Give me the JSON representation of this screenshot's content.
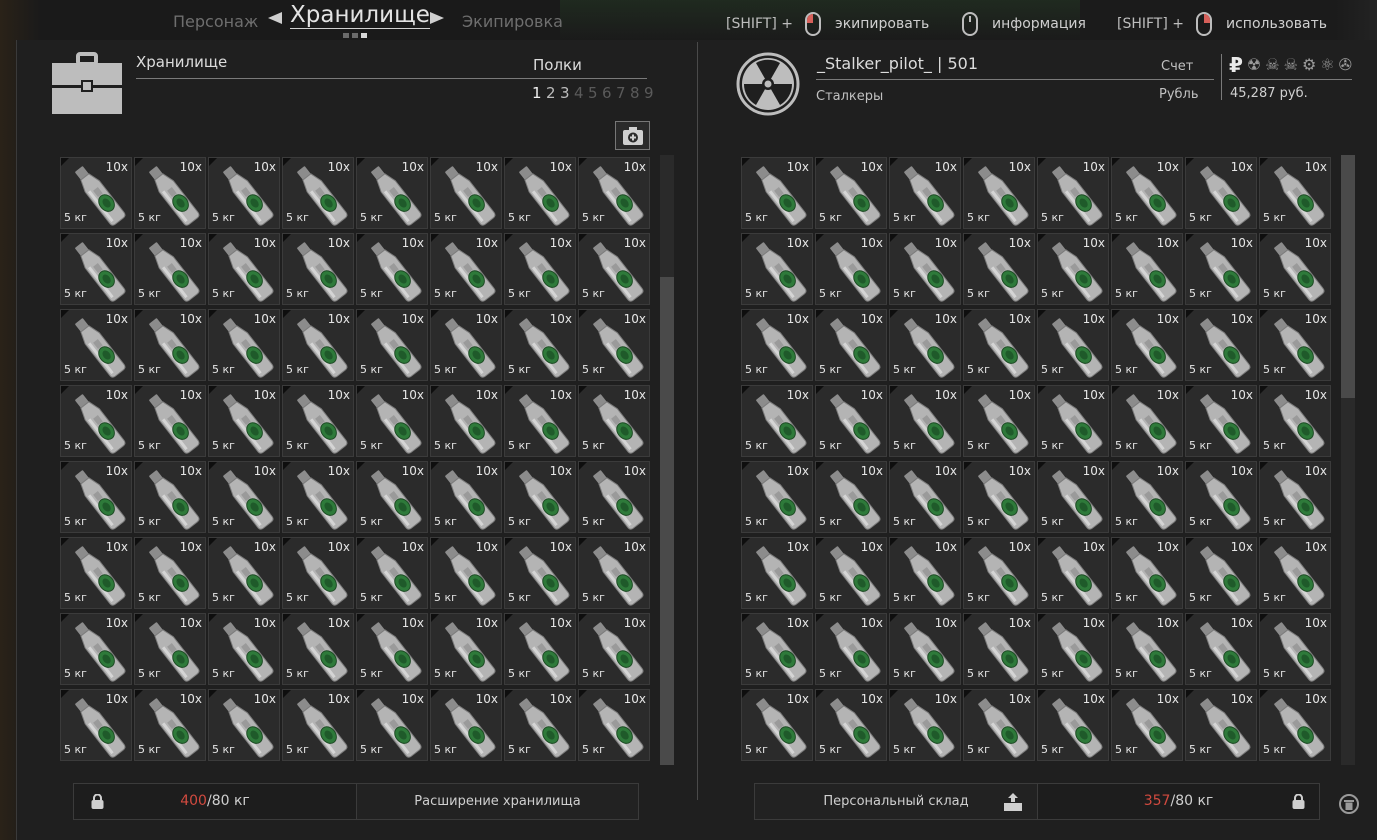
{
  "nav": {
    "prev": "Персонаж",
    "title": "Хранилище",
    "next": "Экипировка",
    "hints": [
      {
        "shift": "[SHIFT] +",
        "mouse": "left",
        "label": "экипировать"
      },
      {
        "shift": "",
        "mouse": "mid",
        "label": "информация"
      },
      {
        "shift": "[SHIFT] +",
        "mouse": "right",
        "label": "использовать"
      }
    ]
  },
  "storage": {
    "title": "Хранилище",
    "shelves_label": "Полки",
    "shelves": [
      "1",
      "2",
      "3",
      "4",
      "5",
      "6",
      "7",
      "8",
      "9"
    ],
    "active_shelf": 1,
    "unlocked_shelves": 3,
    "weight_current": "400",
    "weight_sep": "/",
    "weight_max": "80 кг",
    "expand_label": "Расширение хранилища"
  },
  "player": {
    "name": "_Stalker_pilot_  |  501",
    "group": "Сталкеры",
    "account_label": "Счет",
    "currency_label": "Рубль",
    "currency_symbol": "₽",
    "other_currencies": [
      "☢",
      "☠",
      "☠",
      "⚙",
      "⚛",
      "✇"
    ],
    "balance": "45,287 руб.",
    "personal_storage_label": "Персональный склад",
    "weight_current": "357",
    "weight_sep": "/",
    "weight_max": "80 кг"
  },
  "item": {
    "qty": "10x",
    "weight": "5 кг",
    "icon": "bottle-icon"
  },
  "grid": {
    "rows": 8,
    "cols": 8
  },
  "colors": {
    "accent_red": "#d14a3f",
    "bottle_label": "#2e7a3a"
  }
}
